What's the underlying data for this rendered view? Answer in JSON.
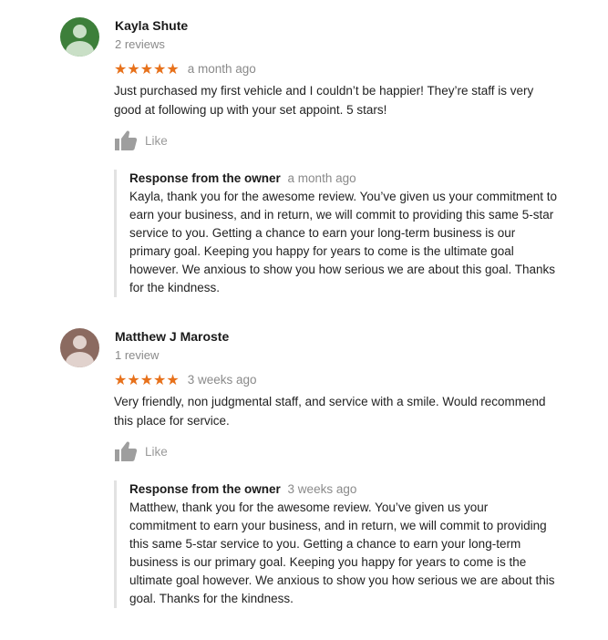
{
  "colors": {
    "star": "#e7711b",
    "avatar_1_bg": "#3d7f3a",
    "avatar_1_fg": "#c9dfc6",
    "avatar_2_bg": "#8b6a60",
    "avatar_2_fg": "#e1d2cd",
    "like_icon": "#9e9e9e",
    "response_border": "#e2e2e2"
  },
  "reviews": [
    {
      "author": "Kayla Shute",
      "review_count": "2 reviews",
      "rating": 5,
      "stars": "★★★★★",
      "time": "a month ago",
      "text": "Just purchased my first vehicle and I couldn’t be happier! They’re staff is very good at following up with your set appoint. 5 stars!",
      "like_label": "Like",
      "like_icon": "thumbs-up-icon",
      "response": {
        "title": "Response from the owner",
        "time": "a month ago",
        "text": "Kayla, thank you for the awesome review. You’ve given us your commitment to earn your business, and in return, we will commit to providing this same 5-star service to you. Getting a chance to earn your long-term business is our primary goal. Keeping you happy for years to come is the ultimate goal however. We anxious to show you how serious we are about this goal. Thanks for the kindness."
      }
    },
    {
      "author": "Matthew J Maroste",
      "review_count": "1 review",
      "rating": 5,
      "stars": "★★★★★",
      "time": "3 weeks ago",
      "text": "Very friendly, non judgmental staff, and service with a smile. Would recommend this place for service.",
      "like_label": "Like",
      "like_icon": "thumbs-up-icon",
      "response": {
        "title": "Response from the owner",
        "time": "3 weeks ago",
        "text": "Matthew, thank you for the awesome review. You’ve given us your commitment to earn your business, and in return, we will commit to providing this same 5-star service to you. Getting a chance to earn your long-term business is our primary goal. Keeping you happy for years to come is the ultimate goal however. We anxious to show you how serious we are about this goal. Thanks for the kindness."
      }
    }
  ]
}
